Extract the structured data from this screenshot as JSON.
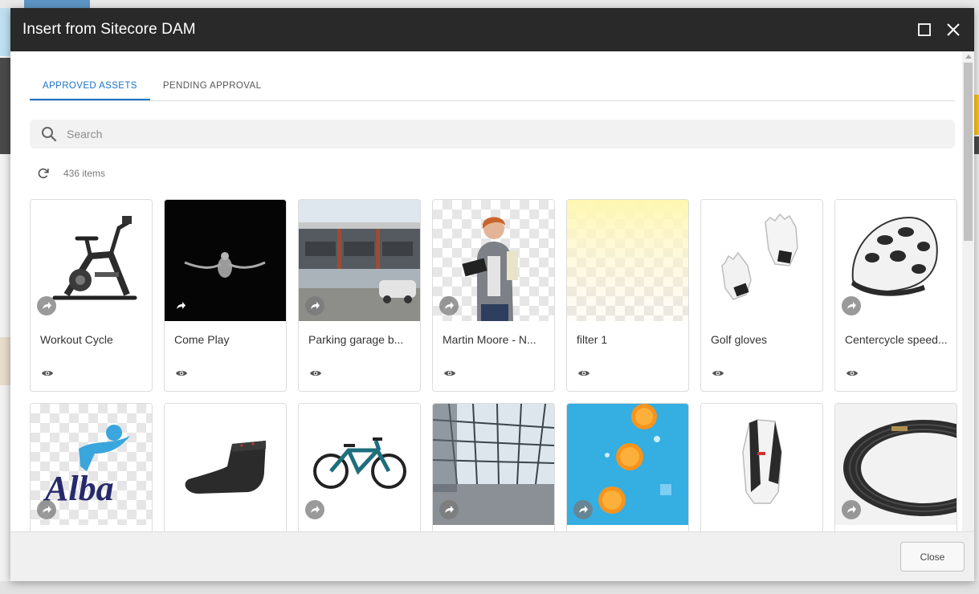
{
  "dialog": {
    "title": "Insert from Sitecore DAM",
    "maximize_icon": "maximize-icon",
    "close_icon": "close-icon"
  },
  "tabs": [
    {
      "label": "APPROVED ASSETS",
      "active": true
    },
    {
      "label": "PENDING APPROVAL",
      "active": false
    }
  ],
  "search": {
    "placeholder": "Search",
    "icon": "search-icon"
  },
  "results": {
    "count_label": "436 items",
    "refresh_icon": "refresh-icon"
  },
  "assets": [
    {
      "title": "Workout Cycle",
      "image": "exercise bike"
    },
    {
      "title": "Come Play",
      "image": "person on black background"
    },
    {
      "title": "Parking garage b...",
      "image": "parking garage"
    },
    {
      "title": "Martin Moore - N...",
      "image": "student with books"
    },
    {
      "title": "filter 1",
      "image": "yellow gradient filter"
    },
    {
      "title": "Golf gloves",
      "image": "pair of golf gloves"
    },
    {
      "title": "Centercycle speed...",
      "image": "bike helmet"
    },
    {
      "title": "",
      "image": "Alba logo",
      "logo_text": "Alba"
    },
    {
      "title": "",
      "image": "sock"
    },
    {
      "title": "",
      "image": "mountain bike"
    },
    {
      "title": "",
      "image": "glass building interior"
    },
    {
      "title": "",
      "image": "oranges on blue"
    },
    {
      "title": "",
      "image": "hydration vest"
    },
    {
      "title": "",
      "image": "bike inner tube"
    }
  ],
  "footer": {
    "close_label": "Close"
  },
  "colors": {
    "accent": "#1a73c8",
    "titlebar": "#292929"
  }
}
